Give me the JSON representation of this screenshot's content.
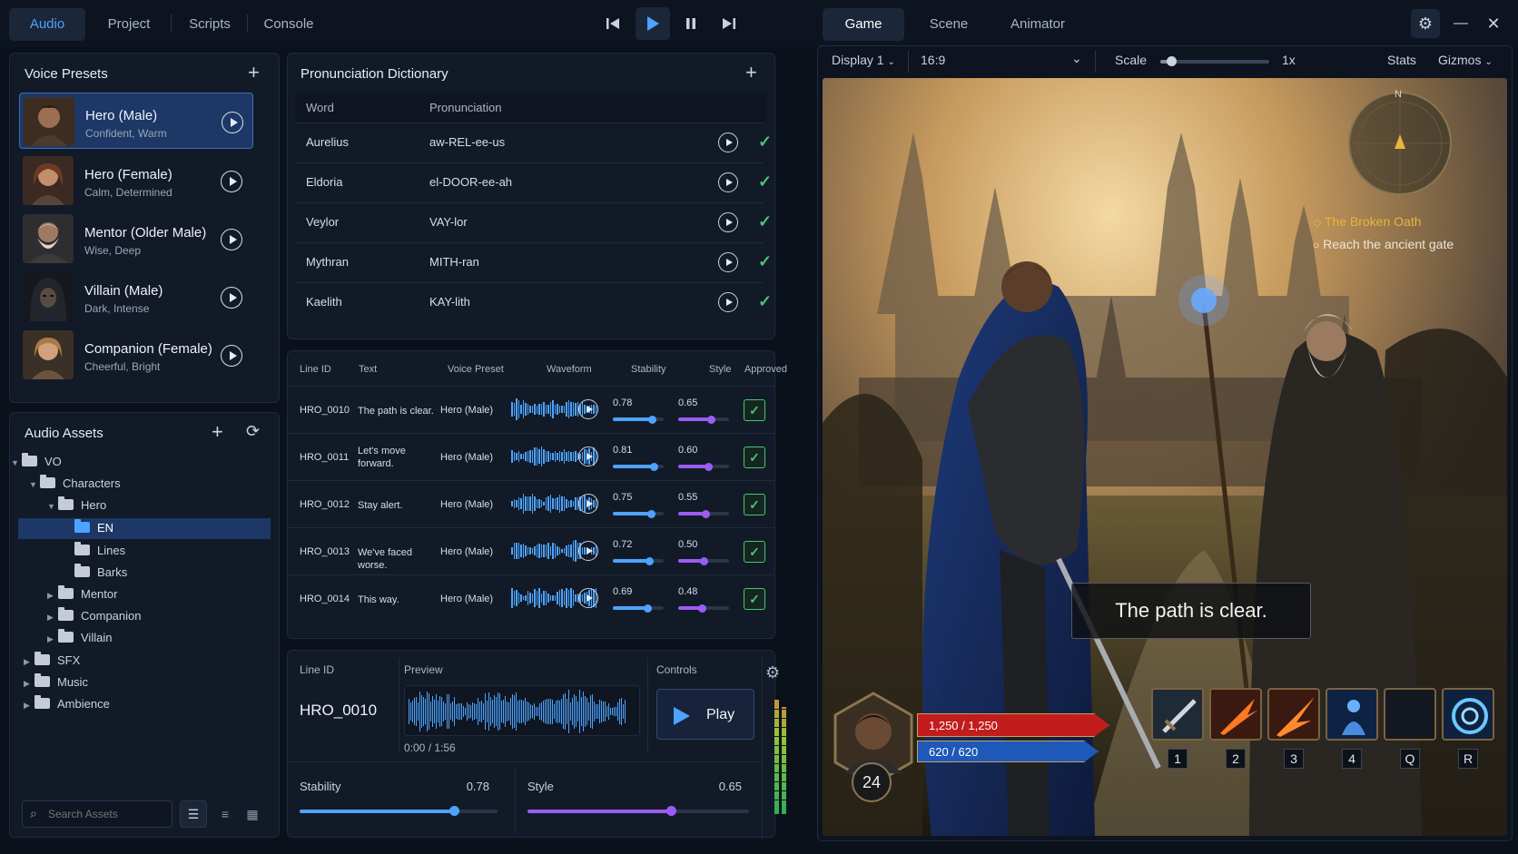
{
  "top_tabs": {
    "audio": "Audio",
    "project": "Project",
    "scripts": "Scripts",
    "console": "Console"
  },
  "right_tabs": {
    "game": "Game",
    "scene": "Scene",
    "animator": "Animator"
  },
  "voice_presets": {
    "title": "Voice Presets",
    "items": [
      {
        "name": "Hero (Male)",
        "desc": "Confident, Warm"
      },
      {
        "name": "Hero (Female)",
        "desc": "Calm, Determined"
      },
      {
        "name": "Mentor (Older Male)",
        "desc": "Wise, Deep"
      },
      {
        "name": "Villain (Male)",
        "desc": "Dark, Intense"
      },
      {
        "name": "Companion (Female)",
        "desc": "Cheerful, Bright"
      }
    ]
  },
  "audio_assets": {
    "title": "Audio Assets",
    "tree": {
      "vo": "VO",
      "characters": "Characters",
      "hero": "Hero",
      "en": "EN",
      "lines": "Lines",
      "barks": "Barks",
      "mentor": "Mentor",
      "companion": "Companion",
      "villain": "Villain",
      "sfx": "SFX",
      "music": "Music",
      "ambience": "Ambience"
    },
    "search_placeholder": "Search Assets"
  },
  "pronunciation": {
    "title": "Pronunciation Dictionary",
    "col_word": "Word",
    "col_pron": "Pronunciation",
    "rows": [
      {
        "word": "Aurelius",
        "pron": "aw-REL-ee-us"
      },
      {
        "word": "Eldoria",
        "pron": "el-DOOR-ee-ah"
      },
      {
        "word": "Veylor",
        "pron": "VAY-lor"
      },
      {
        "word": "Mythran",
        "pron": "MITH-ran"
      },
      {
        "word": "Kaelith",
        "pron": "KAY-lith"
      }
    ]
  },
  "lines": {
    "headers": {
      "id": "Line ID",
      "text": "Text",
      "preset": "Voice Preset",
      "wave": "Waveform",
      "stability": "Stability",
      "style": "Style",
      "approved": "Approved"
    },
    "rows": [
      {
        "id": "HRO_0010",
        "text": "The path is clear.",
        "preset": "Hero (Male)",
        "stability": "0.78",
        "style": "0.65",
        "stab": 0.78,
        "sty": 0.65
      },
      {
        "id": "HRO_0011",
        "text": "Let's move forward.",
        "preset": "Hero (Male)",
        "stability": "0.81",
        "style": "0.60",
        "stab": 0.81,
        "sty": 0.6
      },
      {
        "id": "HRO_0012",
        "text": "Stay alert.",
        "preset": "Hero (Male)",
        "stability": "0.75",
        "style": "0.55",
        "stab": 0.75,
        "sty": 0.55
      },
      {
        "id": "HRO_0013",
        "text": "We've faced worse.",
        "preset": "Hero (Male)",
        "stability": "0.72",
        "style": "0.50",
        "stab": 0.72,
        "sty": 0.5
      },
      {
        "id": "HRO_0014",
        "text": "This way.",
        "preset": "Hero (Male)",
        "stability": "0.69",
        "style": "0.48",
        "stab": 0.69,
        "sty": 0.48
      }
    ]
  },
  "preview": {
    "line_id_label": "Line ID",
    "line_id": "HRO_0010",
    "preview_label": "Preview",
    "controls_label": "Controls",
    "time": "0:00 / 1:56",
    "play_label": "Play",
    "stability_label": "Stability",
    "stability_value": "0.78",
    "stability": 0.78,
    "style_label": "Style",
    "style_value": "0.65",
    "style": 0.65
  },
  "game_toolbar": {
    "display": "Display 1",
    "aspect": "16:9",
    "scale_label": "Scale",
    "scale_value": "1x",
    "stats": "Stats",
    "gizmos": "Gizmos",
    "scale": 0.1
  },
  "game": {
    "quest_title": "The Broken Oath",
    "quest_objective": "Reach the ancient gate",
    "subtitle": "The path is clear.",
    "compass_n": "N",
    "hp": "1,250 / 1,250",
    "mp": "620 / 620",
    "level": "24",
    "hotkeys": [
      "1",
      "2",
      "3",
      "4",
      "Q",
      "R"
    ]
  },
  "colors": {
    "accent": "#4da3ff",
    "style_accent": "#9b5cf6",
    "approved": "#48c774"
  }
}
